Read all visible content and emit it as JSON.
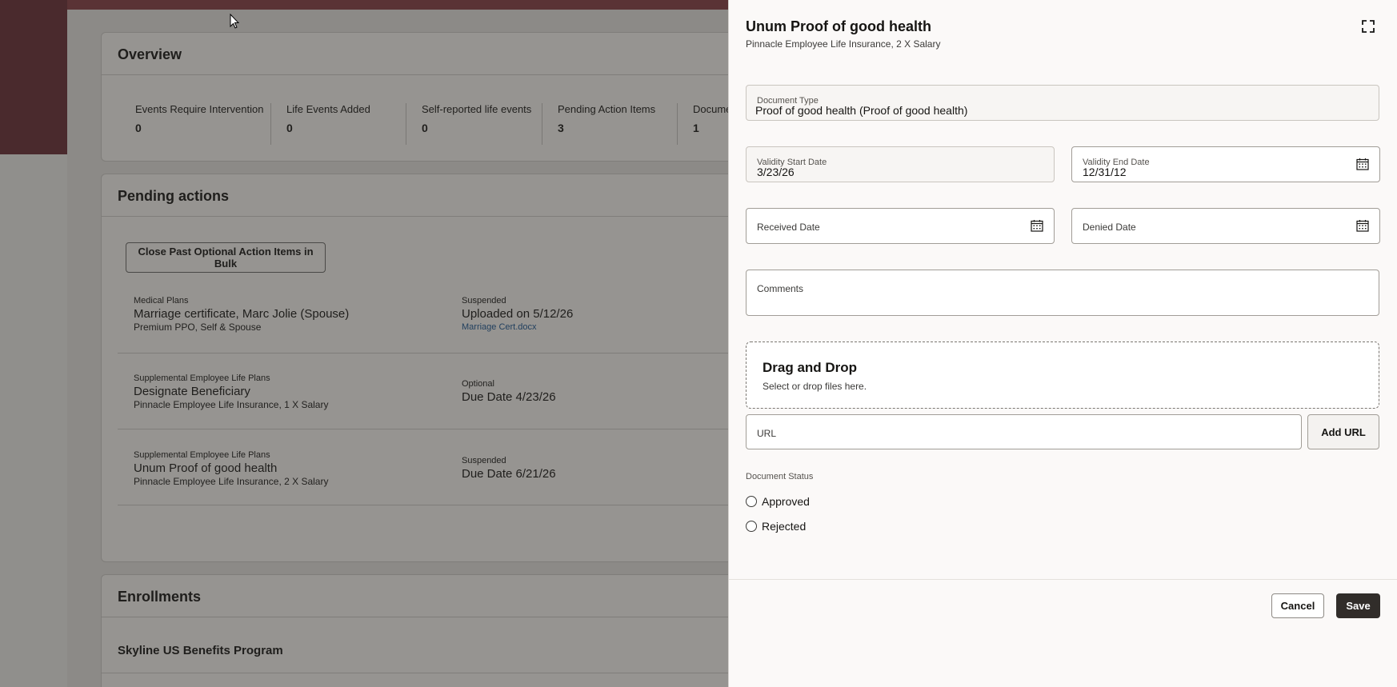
{
  "overview": {
    "title": "Overview",
    "stats": [
      {
        "label": "Events Require Intervention",
        "value": "0"
      },
      {
        "label": "Life Events Added",
        "value": "0"
      },
      {
        "label": "Self-reported life events",
        "value": "0"
      },
      {
        "label": "Pending Action Items",
        "value": "3"
      },
      {
        "label": "Docume",
        "value": "1"
      }
    ]
  },
  "pending": {
    "title": "Pending actions",
    "bulk_button": "Close Past Optional Action Items in Bulk",
    "items": [
      {
        "category": "Medical Plans",
        "title": "Marriage certificate, Marc Jolie (Spouse)",
        "subtitle": "Premium PPO, Self & Spouse",
        "status": "Suspended",
        "when": "Uploaded on 5/12/26",
        "link": "Marriage Cert.docx"
      },
      {
        "category": "Supplemental Employee Life Plans",
        "title": "Designate Beneficiary",
        "subtitle": "Pinnacle Employee Life Insurance, 1 X Salary",
        "status": "Optional",
        "when": "Due Date 4/23/26",
        "link": ""
      },
      {
        "category": "Supplemental Employee Life Plans",
        "title": "Unum Proof of good health",
        "subtitle": "Pinnacle Employee Life Insurance, 2 X Salary",
        "status": "Suspended",
        "when": "Due Date 6/21/26",
        "link": ""
      }
    ]
  },
  "enrollments": {
    "title": "Enrollments",
    "program": "Skyline US Benefits Program"
  },
  "drawer": {
    "title": "Unum Proof of good health",
    "subtitle": "Pinnacle Employee Life Insurance, 2 X Salary",
    "expand_icon": "expand-icon",
    "document_type": {
      "label": "Document Type",
      "value": "Proof of good health (Proof of good health)"
    },
    "validity_start": {
      "label": "Validity Start Date",
      "value": "3/23/26"
    },
    "validity_end": {
      "label": "Validity End Date",
      "value": "12/31/12"
    },
    "received_date": {
      "label": "Received Date",
      "value": ""
    },
    "denied_date": {
      "label": "Denied Date",
      "value": ""
    },
    "comments": {
      "label": "Comments",
      "value": ""
    },
    "dropzone": {
      "title": "Drag and Drop",
      "subtitle": "Select or drop files here."
    },
    "url": {
      "label": "URL",
      "value": ""
    },
    "add_url_button": "Add URL",
    "document_status": {
      "label": "Document Status",
      "options": [
        "Approved",
        "Rejected"
      ],
      "selected": ""
    },
    "cancel_button": "Cancel",
    "save_button": "Save"
  }
}
